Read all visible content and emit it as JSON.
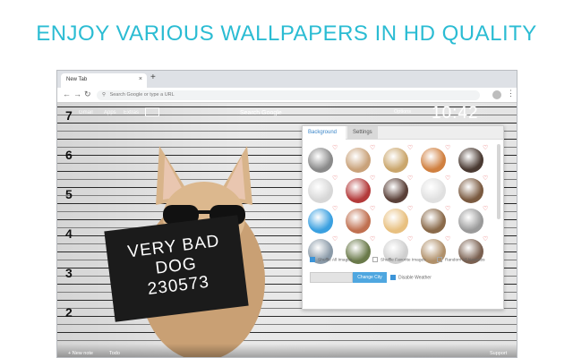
{
  "headline": "ENJOY VARIOUS WALLPAPERS IN HD QUALITY",
  "browser": {
    "tab_title": "New Tab",
    "tab_close": "×",
    "new_tab": "+",
    "omnibox_placeholder": "Search Google or type a URL",
    "back": "←",
    "forward": "→",
    "reload": "↻",
    "menu": "⋮"
  },
  "page": {
    "topbar_links": [
      "Gmail",
      "Apps",
      "Extras"
    ],
    "search_label": "Search Google",
    "options_label": "Options",
    "clock": "10:42",
    "height_scale": [
      "7",
      "6",
      "5",
      "4",
      "3",
      "2"
    ],
    "plaque_lines": [
      "VERY BAD",
      "DOG",
      "230573"
    ],
    "bottom_left": "+ New note",
    "bottom_mid": "Todo",
    "bottom_right": "Support"
  },
  "panel": {
    "tabs": [
      {
        "label": "Background",
        "active": true
      },
      {
        "label": "Settings",
        "active": false
      }
    ],
    "thumbnails": [
      {
        "name": "thumb-1",
        "color": "#8a8a8a"
      },
      {
        "name": "thumb-2",
        "color": "#c9a27a"
      },
      {
        "name": "thumb-3",
        "color": "#caa66c"
      },
      {
        "name": "thumb-4",
        "color": "#d08040"
      },
      {
        "name": "thumb-5",
        "color": "#4a3a32"
      },
      {
        "name": "thumb-6",
        "color": "#d7d7d7"
      },
      {
        "name": "thumb-7",
        "color": "#b33a3a"
      },
      {
        "name": "thumb-8",
        "color": "#5a4038"
      },
      {
        "name": "thumb-9",
        "color": "#e0e0e0"
      },
      {
        "name": "thumb-10",
        "color": "#7a5a40"
      },
      {
        "name": "thumb-11",
        "color": "#3aa0e0"
      },
      {
        "name": "thumb-12",
        "color": "#c07050"
      },
      {
        "name": "thumb-13",
        "color": "#e8c080"
      },
      {
        "name": "thumb-14",
        "color": "#8a6a4a"
      },
      {
        "name": "thumb-15",
        "color": "#9a9a9a"
      },
      {
        "name": "thumb-16",
        "color": "#8a9aa8"
      },
      {
        "name": "thumb-17",
        "color": "#6a7a4a"
      },
      {
        "name": "thumb-18",
        "color": "#cfcfcf"
      },
      {
        "name": "thumb-19",
        "color": "#b0906a"
      },
      {
        "name": "thumb-20",
        "color": "#7a6050"
      }
    ],
    "options": [
      {
        "label": "Shuffle All Images",
        "checked": true
      },
      {
        "label": "Shuffle Favorite Images",
        "checked": false
      },
      {
        "label": "Random All Newtabs",
        "checked": false
      }
    ],
    "city_value": "",
    "change_city_label": "Change City",
    "weather_label": "Disable Weather",
    "weather_checked": true
  },
  "colors": {
    "accent": "#2bbcd3",
    "button_blue": "#4fa7e0",
    "heart": "#e25a5a"
  }
}
